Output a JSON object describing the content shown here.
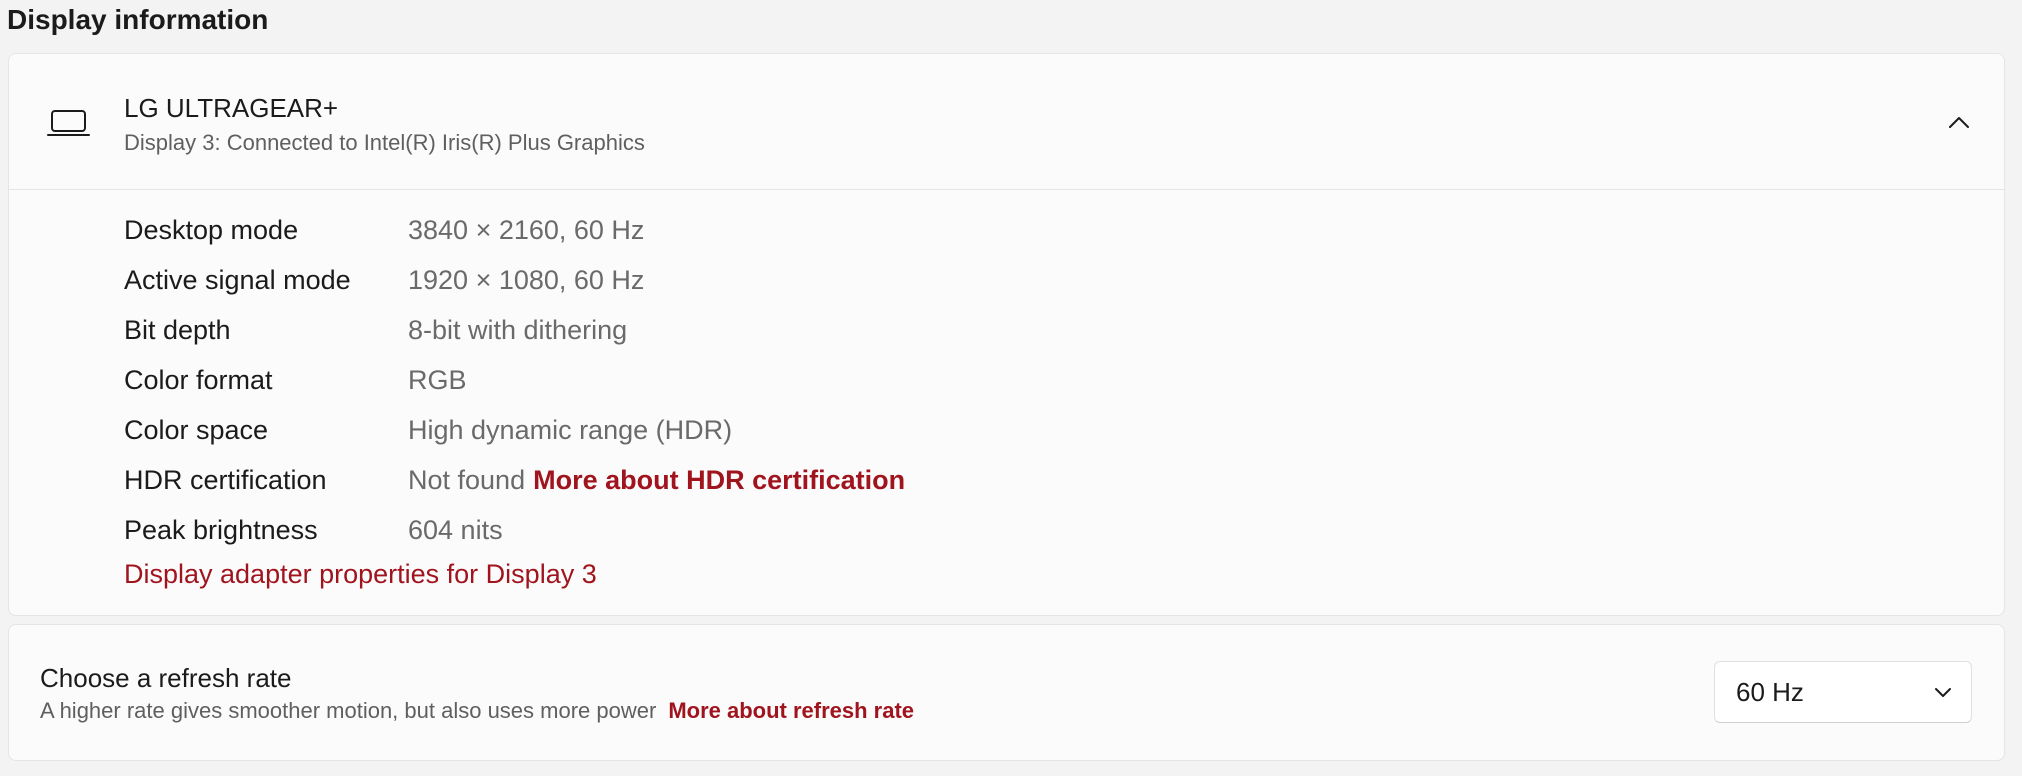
{
  "section": {
    "title": "Display information"
  },
  "display": {
    "name": "LG ULTRAGEAR+",
    "subtitle": "Display 3: Connected to Intel(R) Iris(R) Plus Graphics",
    "icon": "laptop-icon",
    "expanded": true,
    "rows": [
      {
        "label": "Desktop mode",
        "value": "3840 × 2160, 60 Hz"
      },
      {
        "label": "Active signal mode",
        "value": "1920 × 1080, 60 Hz"
      },
      {
        "label": "Bit depth",
        "value": "8-bit with dithering"
      },
      {
        "label": "Color format",
        "value": "RGB"
      },
      {
        "label": "Color space",
        "value": "High dynamic range (HDR)"
      },
      {
        "label": "HDR certification",
        "value": "Not found",
        "link": "More about HDR certification"
      },
      {
        "label": "Peak brightness",
        "value": "604 nits"
      }
    ],
    "adapter_link": "Display adapter properties for Display 3"
  },
  "refresh": {
    "title": "Choose a refresh rate",
    "description": "A higher rate gives smoother motion, but also uses more power",
    "link": "More about refresh rate",
    "selected": "60 Hz"
  },
  "colors": {
    "accent_link": "#a0141e",
    "background": "#f3f3f3",
    "card": "#fbfbfb"
  }
}
